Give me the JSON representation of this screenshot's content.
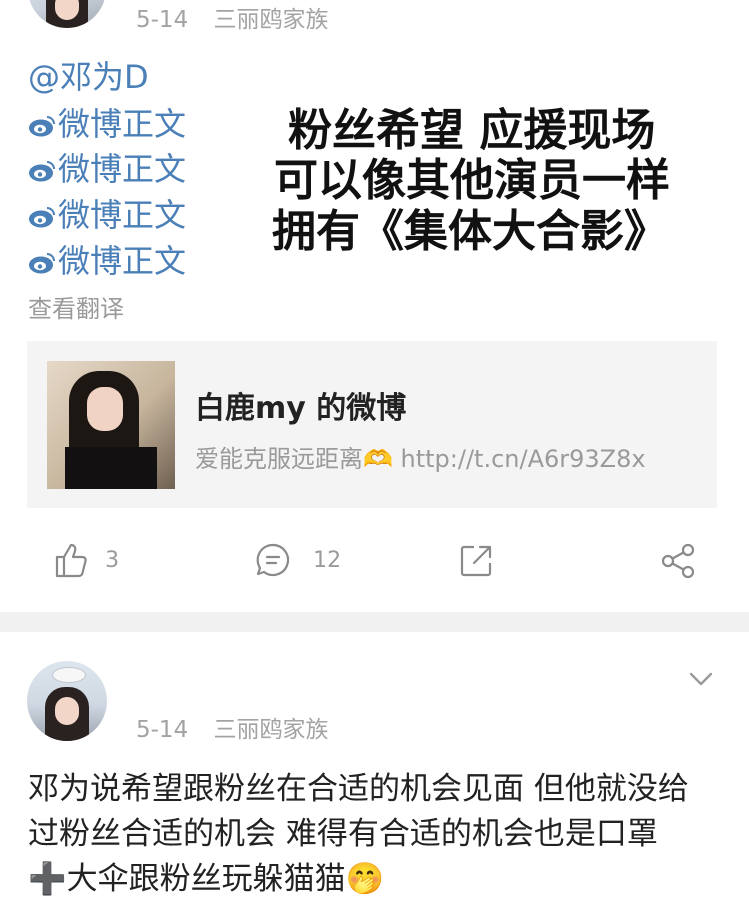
{
  "post1": {
    "date": "5-14",
    "source": "三丽鸥家族",
    "mention": "@邓为D",
    "links": [
      "微博正文",
      "微博正文",
      "微博正文",
      "微博正文"
    ],
    "translate": "查看翻译",
    "overlay_lines": [
      "粉丝希望 应援现场",
      "可以像其他演员一样",
      "拥有《集体大合影》"
    ],
    "card": {
      "title": "白鹿my 的微博",
      "subtitle": "爱能克服远距离🫶 http://t.cn/A6r93Z8x"
    },
    "actions": {
      "likes": "3",
      "comments": "12"
    }
  },
  "post2": {
    "date": "5-14",
    "source": "三丽鸥家族",
    "text_lines": [
      "邓为说希望跟粉丝在合适的机会见面 但他就没给",
      "过粉丝合适的机会 难得有合适的机会也是口罩",
      "➕大伞跟粉丝玩躲猫猫🤭"
    ]
  },
  "colors": {
    "link": "#4a7fb8",
    "meta": "#a3a3a3",
    "card_bg": "#f4f4f4"
  }
}
